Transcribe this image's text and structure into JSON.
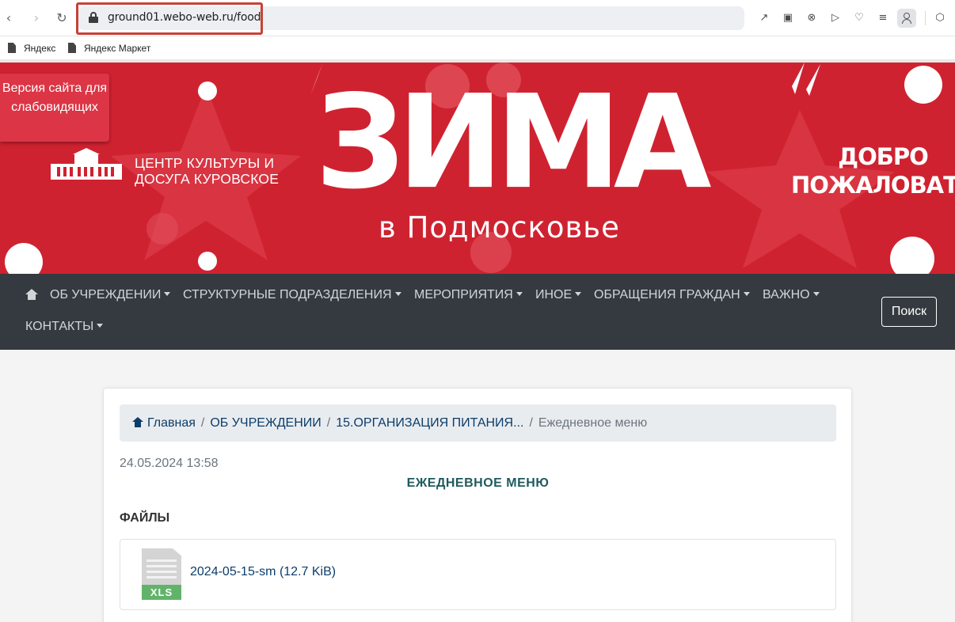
{
  "browser": {
    "url": "ground01.webo-web.ru/food",
    "icons": [
      "back-icon",
      "forward-icon",
      "reload-icon",
      "lock-icon",
      "share-icon",
      "screenshot-icon",
      "shield-icon",
      "play-icon",
      "heart-icon",
      "reader-icon",
      "profile-icon",
      "extensions-icon"
    ],
    "bookmarks": [
      "Яндекс",
      "Яндекс Маркет"
    ]
  },
  "banner": {
    "vision_label": "Версия сайта для слабовидящих",
    "org_name_line1": "ЦЕНТР КУЛЬТУРЫ И",
    "org_name_line2": "ДОСУГА КУРОВСКОЕ",
    "headline": "ЗИМА",
    "subheadline": "в Подмосковье",
    "welcome_line1": "ДОБРО",
    "welcome_line2": "ПОЖАЛОВАТЬ",
    "background_color": "#cf2230"
  },
  "nav": {
    "items": [
      "ОБ УЧРЕЖДЕНИИ",
      "СТРУКТУРНЫЕ ПОДРАЗДЕЛЕНИЯ",
      "МЕРОПРИЯТИЯ",
      "ИНОЕ",
      "ОБРАЩЕНИЯ ГРАЖДАН",
      "ВАЖНО",
      "КОНТАКТЫ"
    ],
    "search_label": "Поиск",
    "background_color": "#343a40"
  },
  "breadcrumb": {
    "home": "Главная",
    "level1": "ОБ УЧРЕЖДЕНИИ",
    "level2": "15.ОРГАНИЗАЦИЯ ПИТАНИЯ...",
    "current": "Ежедневное меню"
  },
  "post": {
    "date": "24.05.2024 13:58",
    "title": "ЕЖЕДНЕВНОЕ МЕНЮ",
    "files_heading": "ФАЙЛЫ",
    "files": [
      {
        "name": "2024-05-15-sm (12.7 KiB)",
        "type_label": "XLS"
      }
    ]
  }
}
